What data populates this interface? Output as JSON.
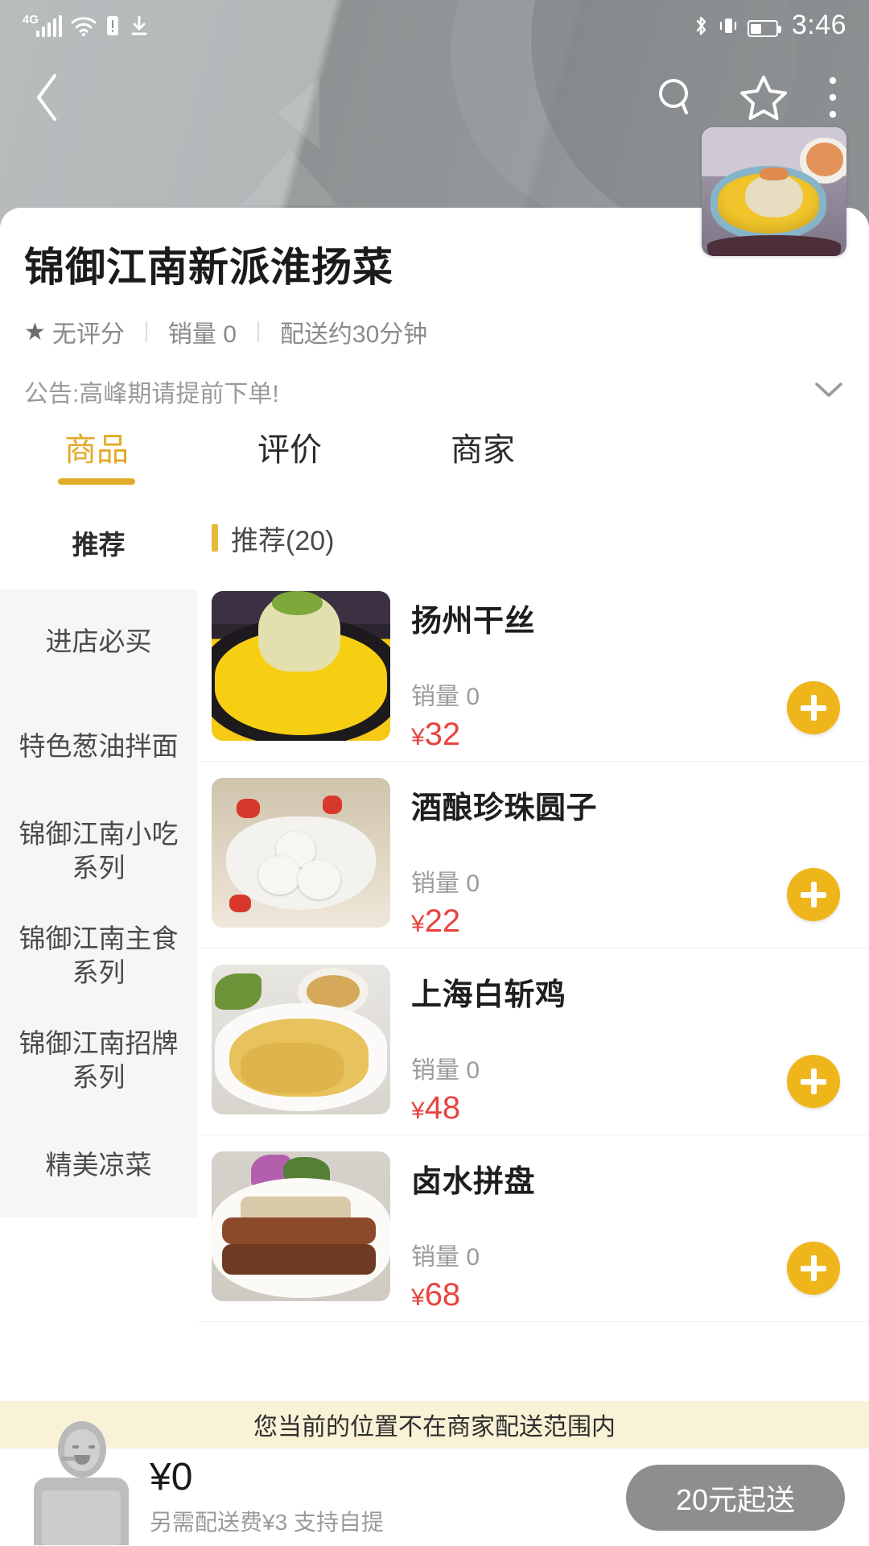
{
  "statusbar": {
    "network": "4G",
    "time": "3:46",
    "icons": [
      "signal-icon",
      "wifi-icon",
      "sim-alert-icon",
      "download-icon",
      "bluetooth-icon",
      "vibrate-icon",
      "battery-icon"
    ]
  },
  "navbar": {
    "back": "back-icon",
    "search": "search-icon",
    "favorite": "star-outline-icon",
    "more": "more-vertical-icon"
  },
  "shop": {
    "name": "锦御江南新派淮扬菜",
    "rating_label": "无评分",
    "sales_label": "销量 0",
    "delivery_label": "配送约30分钟",
    "notice": "公告:高峰期请提前下单!",
    "expand_icon": "chevron-down-icon",
    "logo_alt": "shop-logo"
  },
  "tabs": [
    {
      "label": "商品",
      "active": true
    },
    {
      "label": "评价",
      "active": false
    },
    {
      "label": "商家",
      "active": false
    }
  ],
  "sidebar": {
    "items": [
      {
        "label": "推荐",
        "active": true
      },
      {
        "label": "进店必买",
        "active": false
      },
      {
        "label": "特色葱油拌面",
        "active": false
      },
      {
        "label": "锦御江南小吃系列",
        "active": false
      },
      {
        "label": "锦御江南主食系列",
        "active": false
      },
      {
        "label": "锦御江南招牌系列",
        "active": false
      },
      {
        "label": "精美凉菜",
        "active": false
      }
    ]
  },
  "section": {
    "title": "推荐(20)"
  },
  "dishes": [
    {
      "name": "扬州干丝",
      "sales": "销量 0",
      "currency": "¥",
      "price": "32",
      "add": "add-icon"
    },
    {
      "name": "酒酿珍珠圆子",
      "sales": "销量 0",
      "currency": "¥",
      "price": "22",
      "add": "add-icon"
    },
    {
      "name": "上海白斩鸡",
      "sales": "销量 0",
      "currency": "¥",
      "price": "48",
      "add": "add-icon"
    },
    {
      "name": "卤水拼盘",
      "sales": "销量 0",
      "currency": "¥",
      "price": "68",
      "add": "add-icon"
    }
  ],
  "warning": {
    "text": "您当前的位置不在商家配送范围内"
  },
  "bottom": {
    "cart_total": "¥0",
    "cart_note": "另需配送费¥3 支持自提",
    "order_button": "20元起送"
  },
  "colors": {
    "accent_gold": "#e2ab28",
    "add_button": "#efb61c",
    "price_red": "#e8433f",
    "warning_bg": "#f9f2d6",
    "disabled_button": "#8e8e8e"
  }
}
